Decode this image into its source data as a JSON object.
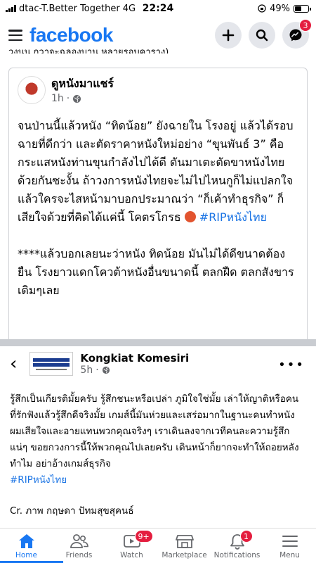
{
  "status_bar": {
    "carrier": "dtac-T.Better Together",
    "network": "4G",
    "time": "22:24",
    "battery": "49%",
    "battery_level": 0.49
  },
  "header": {
    "logo": "facebook",
    "icons": [
      "plus-icon",
      "search-icon",
      "messenger-icon"
    ],
    "messenger_badge": "3"
  },
  "cut_line_text": "วงนน กวาจะฉลองบาน หลายรอบคาราง)",
  "shared_post": {
    "author": "ดูหนังมาแชร์",
    "time": "1h",
    "paragraph1": "จนป่านนี้แล้วหนัง “ทิดน้อย” ยังฉายใน โรงอยู่ แล้วได้รอบฉายที่ดีกว่า และตัดราคาหนังใหม่อย่าง “ขุนพันธ์ 3” คือกระแสหนังท่านขุนกำลังไปได้ดี ดันมาเตะตัดขาหนังไทยด้วยกันซะงั้น ถ้าวงการหนังไทยจะไม่ไปไหนกูก็ไม่แปลกใจ แล้วใครจะไสหน้ามาบอกประมาณว่า “ก็เค้าทำธุรกิจ” ก็เสียใจด้วยที่คิดได้แค่นี้ โคตรโกรธ",
    "hashtag1": "#RIPหนังไทย",
    "paragraph2": "****แล้วบอกเลยนะว่าหนัง ทิดน้อย มันไม่ได้ดีขนาดต้องยืน โรงยาวแดกโควต้าหนังอื่นขนาดนี้ ตลกฝืด ตลกสังขารเดิมๆเลย"
  },
  "post2": {
    "page_name": "Kongkiat Komesiri",
    "time": "5h",
    "text": "รู้สึกเป็นเกียรติมั้ยครับ รู้สึกชนะหรือเปล่า ภูมิใจใช่มั้ย เล่าให้ญาติหรือคนที่รักฟังแล้วรู้สึกดีจริงมั้ย เกมส์นี้มันห่วยและเสร่อมากในฐานะคนทำหนัง ผมเสียใจและอายแทนพวกคุณจริงๆ เราเดินลงจากเวทีคนละความรู้สึกแน่ๆ ขอยกวงการนี้ให้พวกคุณไปเลยครับ เดินหน้าก็ยากจะทำให้ถอยหลังทำไม อย่าอ้างเกมส์ธุรกิจ",
    "hashtag": "#RIPหนังไทย",
    "credit": "Cr. ภาพ กฤษดา ปัทมสุขสุคนธ์"
  },
  "bottom_nav": [
    {
      "label": "Home",
      "icon": "home-icon",
      "active": true,
      "badge": ""
    },
    {
      "label": "Friends",
      "icon": "friends-icon",
      "active": false,
      "badge": ""
    },
    {
      "label": "Watch",
      "icon": "watch-icon",
      "active": false,
      "badge": "9+"
    },
    {
      "label": "Marketplace",
      "icon": "marketplace-icon",
      "active": false,
      "badge": ""
    },
    {
      "label": "Notifications",
      "icon": "bell-icon",
      "active": false,
      "badge": "1"
    },
    {
      "label": "Menu",
      "icon": "menu-icon",
      "active": false,
      "badge": ""
    }
  ],
  "colors": {
    "brand": "#1877f2",
    "badge": "#e41e3f",
    "hashtag": "#1b74e4"
  }
}
